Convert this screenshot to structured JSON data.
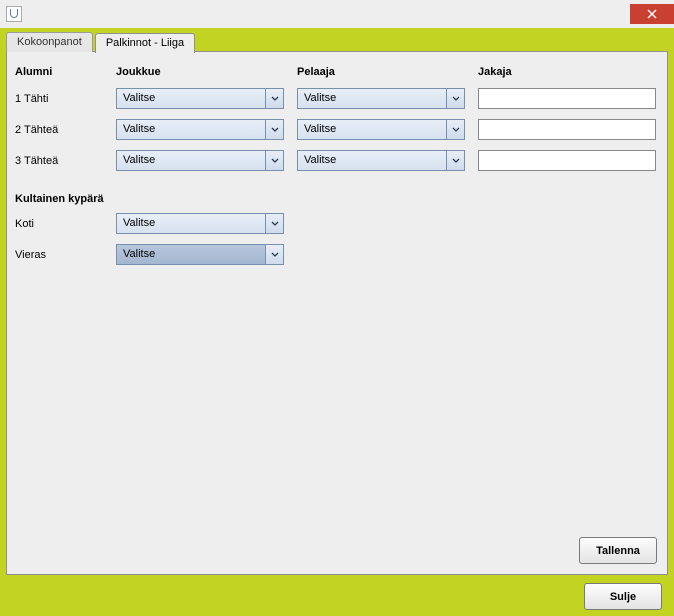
{
  "titlebar": {
    "close_title": "Close"
  },
  "tabs": [
    {
      "label": "Kokoonpanot",
      "active": false
    },
    {
      "label": "Palkinnot - Liiga",
      "active": true
    }
  ],
  "columns": {
    "alumni": "Alumni",
    "joukkue": "Joukkue",
    "pelaaja": "Pelaaja",
    "jakaja": "Jakaja"
  },
  "rows": [
    {
      "label": "1 Tähti",
      "joukkue": "Valitse",
      "pelaaja": "Valitse",
      "jakaja": ""
    },
    {
      "label": "2 Tähteä",
      "joukkue": "Valitse",
      "pelaaja": "Valitse",
      "jakaja": ""
    },
    {
      "label": "3 Tähteä",
      "joukkue": "Valitse",
      "pelaaja": "Valitse",
      "jakaja": ""
    }
  ],
  "section2": {
    "title": "Kultainen kypärä",
    "rows": [
      {
        "label": "Koti",
        "value": "Valitse",
        "focused": false
      },
      {
        "label": "Vieras",
        "value": "Valitse",
        "focused": true
      }
    ]
  },
  "buttons": {
    "tallenna": "Tallenna",
    "sulje": "Sulje"
  }
}
